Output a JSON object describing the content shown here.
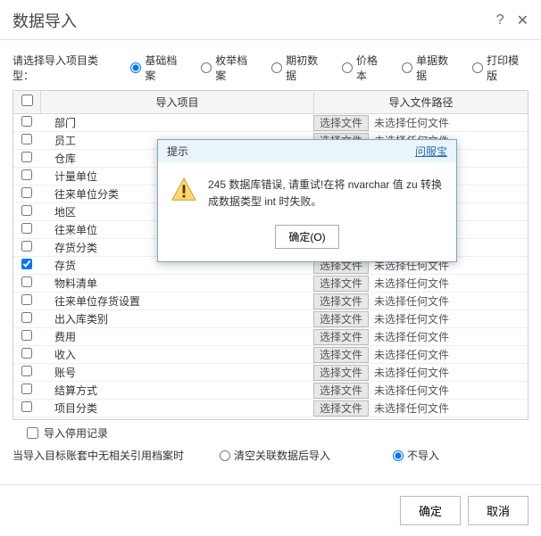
{
  "title": "数据导入",
  "typeLabel": "请选择导入项目类型：",
  "types": [
    {
      "label": "基础档案",
      "checked": true
    },
    {
      "label": "枚举档案",
      "checked": false
    },
    {
      "label": "期初数据",
      "checked": false
    },
    {
      "label": "价格本",
      "checked": false
    },
    {
      "label": "单据数据",
      "checked": false
    },
    {
      "label": "打印模版",
      "checked": false
    }
  ],
  "headers": {
    "item": "导入项目",
    "path": "导入文件路径"
  },
  "selectFile": "选择文件",
  "noFile": "未选择任何文件",
  "rows": [
    {
      "name": "部门",
      "checked": false
    },
    {
      "name": "员工",
      "checked": false
    },
    {
      "name": "仓库",
      "checked": false
    },
    {
      "name": "计量单位",
      "checked": false
    },
    {
      "name": "往来单位分类",
      "checked": false
    },
    {
      "name": "地区",
      "checked": false
    },
    {
      "name": "往来单位",
      "checked": false
    },
    {
      "name": "存货分类",
      "checked": false
    },
    {
      "name": "存货",
      "checked": true
    },
    {
      "name": "物料清单",
      "checked": false
    },
    {
      "name": "往来单位存货设置",
      "checked": false
    },
    {
      "name": "出入库类别",
      "checked": false
    },
    {
      "name": "费用",
      "checked": false
    },
    {
      "name": "收入",
      "checked": false
    },
    {
      "name": "账号",
      "checked": false
    },
    {
      "name": "结算方式",
      "checked": false
    },
    {
      "name": "项目分类",
      "checked": false
    }
  ],
  "importDisabled": "导入停用记录",
  "refLabel": "当导入目标账套中无相关引用档案时",
  "refOptions": [
    {
      "label": "清空关联数据后导入",
      "checked": false
    },
    {
      "label": "不导入",
      "checked": true
    }
  ],
  "ok": "确定",
  "cancel": "取消",
  "modal": {
    "title": "提示",
    "help": "问服宝",
    "message": "245 数据库错误, 请重试!在将 nvarchar 值 zu 转换成数据类型 int 时失败。",
    "okLabel": "确定(O)"
  }
}
